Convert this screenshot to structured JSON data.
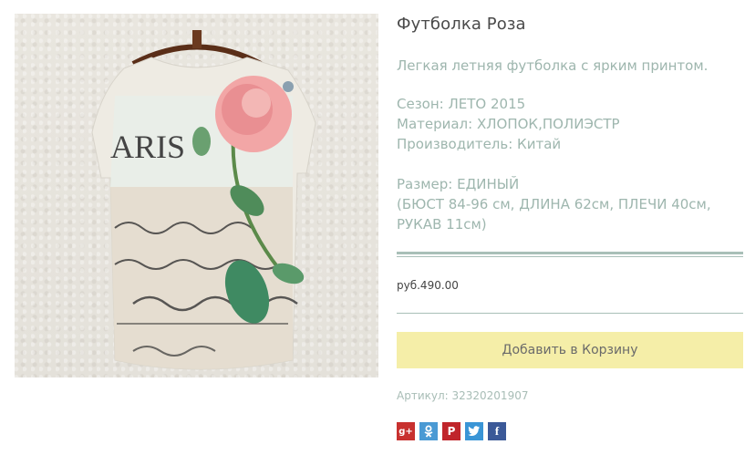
{
  "product": {
    "title": "Футболка Роза",
    "description": "Легкая летняя футболка с ярким принтом.",
    "season": "Сезон: ЛЕТО 2015",
    "material": "Материал: ХЛОПОК,ПОЛИЭСТР",
    "manufacturer": "Производитель: Китай",
    "size": "Размер: ЕДИНЫЙ",
    "size_detail": "(БЮСТ 84-96 см, ДЛИНА 62см, ПЛЕЧИ 40см, РУКАВ 11см)",
    "price": "руб.490.00",
    "add_to_cart_label": "Добавить в Корзину",
    "sku": "Артикул: 32320201907",
    "image_print_text": "ARIS"
  },
  "share": {
    "gplus_label": "g+",
    "fb_label": "f",
    "pin_label": "P",
    "colors": {
      "gplus": "#c8312f",
      "odnoklassniki": "#4a9ad4",
      "pinterest": "#c0252b",
      "twitter": "#3a95d6",
      "facebook": "#3b5998"
    }
  },
  "theme": {
    "accent_text": "#9eb6ae",
    "rule": "#a9bfb8",
    "button_bg": "#f5eea8"
  }
}
